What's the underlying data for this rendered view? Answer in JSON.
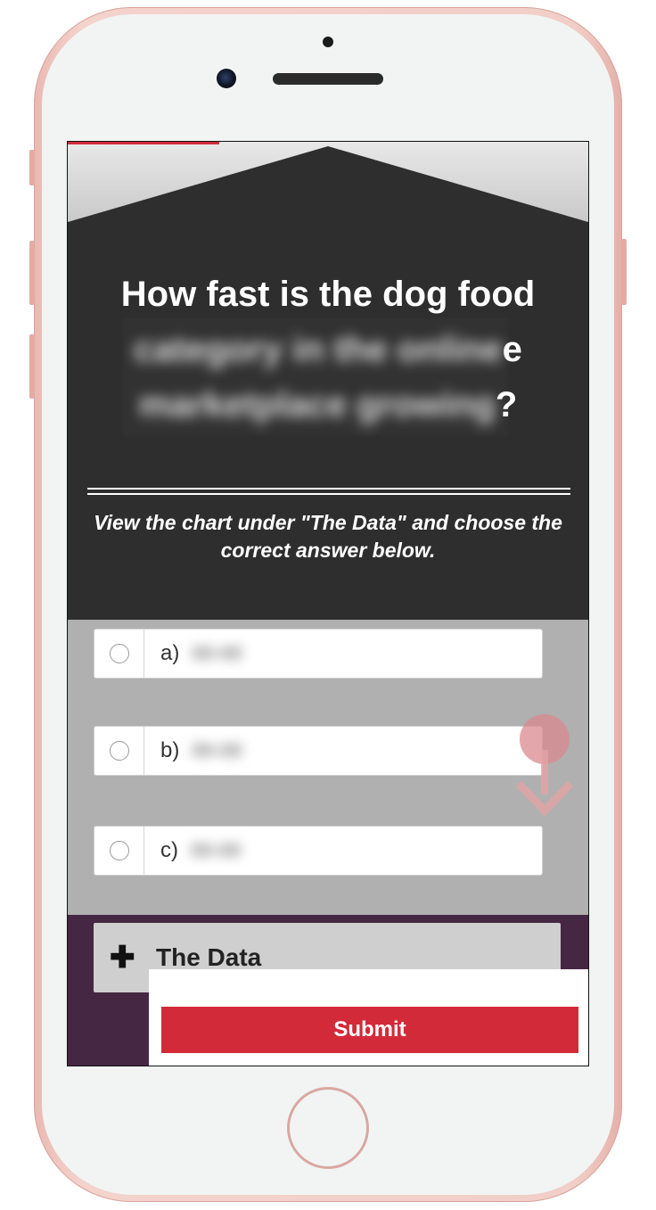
{
  "quiz": {
    "question_visible_1": "How fast is the dog food",
    "question_blurred_2": "category in the online",
    "question_suffix_2": "e",
    "question_blurred_3": "marketplace growing",
    "question_suffix_3": "?",
    "instructions": "View the chart under \"The Data\" and choose the correct answer below.",
    "answers": [
      {
        "label": "a)",
        "value": "00-00"
      },
      {
        "label": "b)",
        "value": "00-00"
      },
      {
        "label": "c)",
        "value": "00-00"
      }
    ],
    "data_toggle_icon": "plus-icon",
    "data_title": "The Data",
    "submit_label": "Submit"
  },
  "colors": {
    "phone_frame": "#f1cfc8",
    "hero_background": "#2e2e2e",
    "answers_background": "#b0b0b0",
    "data_section": "#452743",
    "submit": "#d32a3a"
  },
  "icons": {
    "scroll_hint": "scroll-down-arrow-icon",
    "camera": "camera-icon",
    "home": "home-button-icon"
  }
}
